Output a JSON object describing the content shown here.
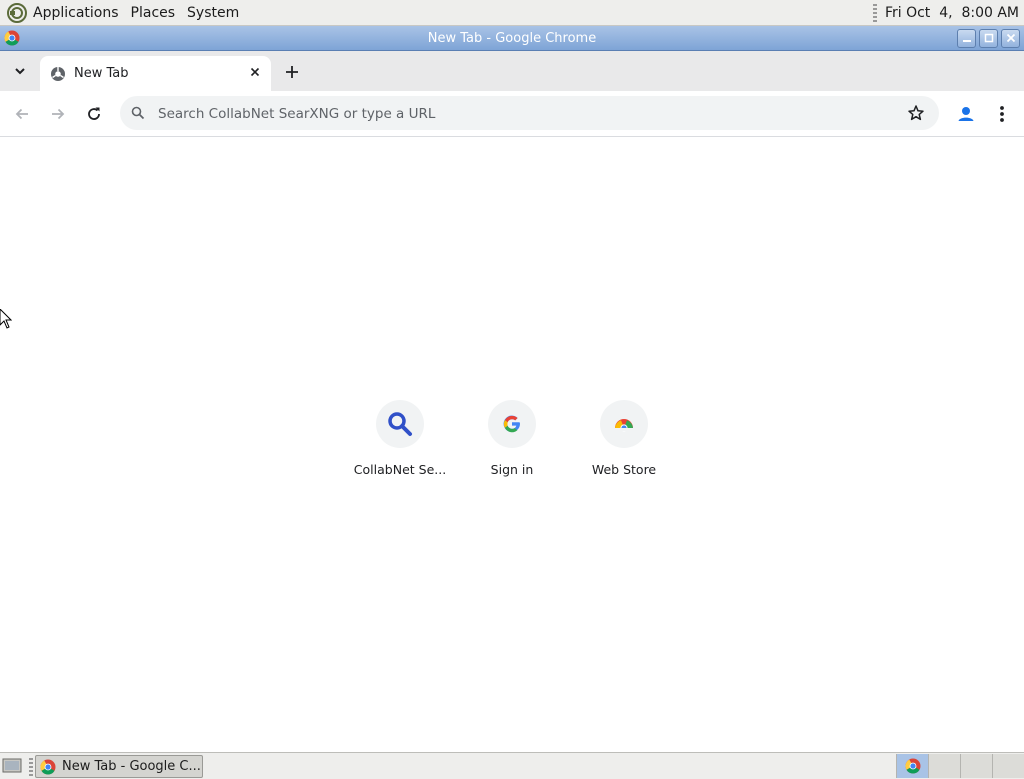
{
  "top_panel": {
    "menus": [
      "Applications",
      "Places",
      "System"
    ],
    "clock": "Fri Oct  4,  8:00 AM"
  },
  "window": {
    "title": "New Tab - Google Chrome",
    "buttons": [
      "minimize-icon",
      "maximize-icon",
      "close-icon"
    ]
  },
  "tabs": [
    {
      "title": "New Tab",
      "icon": "chrome-newtab-icon"
    }
  ],
  "toolbar": {
    "back_icon": "arrow-left-icon",
    "forward_icon": "arrow-right-icon",
    "reload_icon": "reload-icon",
    "omnibox_placeholder": "Search CollabNet SearXNG or type a URL",
    "omnibox_value": ""
  },
  "shortcuts": [
    {
      "label": "CollabNet Se...",
      "icon": "magnifier-icon"
    },
    {
      "label": "Sign in",
      "icon": "google-g-icon"
    },
    {
      "label": "Web Store",
      "icon": "web-store-icon"
    }
  ],
  "taskbar": {
    "tasks": [
      {
        "label": "New Tab - Google C..."
      }
    ],
    "workspaces": 4,
    "active_workspace": 1
  },
  "colors": {
    "titlebar": "#7ea4d6",
    "google_blue": "#4285f4",
    "google_red": "#ea4335",
    "google_yellow": "#fbbc05",
    "google_green": "#34a853"
  }
}
